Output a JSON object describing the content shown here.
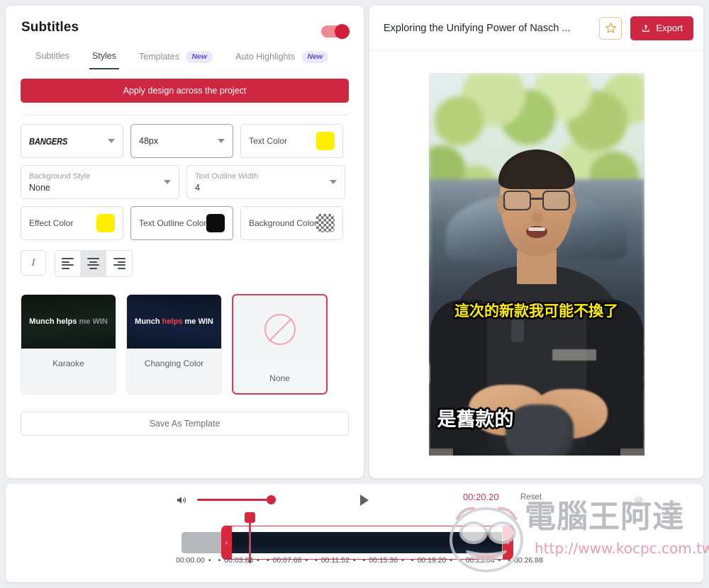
{
  "left_panel": {
    "title": "Subtitles",
    "toggle_on": true,
    "tabs": [
      {
        "label": "Subtitles",
        "active": false,
        "badge": ""
      },
      {
        "label": "Styles",
        "active": true,
        "badge": ""
      },
      {
        "label": "Templates",
        "active": false,
        "badge": "New"
      },
      {
        "label": "Auto Highlights",
        "active": false,
        "badge": "New"
      }
    ],
    "apply_button": "Apply design across the project",
    "controls": {
      "font_family": "BANGERS",
      "font_size": "48px",
      "text_color_label": "Text Color",
      "text_color_value": "#ffef00",
      "background_style_label": "Background Style",
      "background_style_value": "None",
      "text_outline_width_label": "Text Outline Width",
      "text_outline_width_value": "4",
      "effect_color_label": "Effect Color",
      "effect_color_value": "#ffef00",
      "text_outline_color_label": "Text Outline Color",
      "text_outline_color_value": "#0b0b0b",
      "background_color_label": "Background Color",
      "background_color_value": "transparent"
    },
    "style_buttons": {
      "italic": "I",
      "align_left": "align-left",
      "align_center": "align-center",
      "align_right": "align-right",
      "align_selected": "align-center"
    },
    "presets": [
      {
        "name": "Karaoke",
        "preview_words": [
          {
            "text": "Munch ",
            "state": "on"
          },
          {
            "text": "helps ",
            "state": "on"
          },
          {
            "text": "me ",
            "state": "off"
          },
          {
            "text": "WIN",
            "state": "off"
          }
        ],
        "selected": false
      },
      {
        "name": "Changing Color",
        "preview_words": [
          {
            "text": "Munch ",
            "state": "on"
          },
          {
            "text": "helps ",
            "state": "hi"
          },
          {
            "text": "me ",
            "state": "on"
          },
          {
            "text": "WIN",
            "state": "on"
          }
        ],
        "selected": false
      },
      {
        "name": "None",
        "preview_words": [],
        "selected": true
      }
    ],
    "save_template_button": "Save As Template"
  },
  "right_panel": {
    "project_title": "Exploring the Unifying Power of Nasch ...",
    "favorite_icon": "star-icon",
    "export_button": "Export",
    "export_icon": "upload-icon",
    "video": {
      "subtitle_primary": "這次的新款我可能不換了",
      "subtitle_primary_color": "#ffee00",
      "subtitle_secondary": "是舊款的",
      "subtitle_secondary_color": "#ffffff"
    }
  },
  "timeline": {
    "volume_icon": "speaker-icon",
    "volume_value": 100,
    "play_icon": "play-icon",
    "current_time": "00:20.20",
    "reset_button": "Reset",
    "markers": [
      "00:00.00",
      "00:03.84",
      "00:07.68",
      "00:11.52",
      "00:15.36",
      "00:19.20",
      "00:23.04",
      "00:26.88"
    ],
    "handle_left_icon": "chevron-left-icon",
    "handle_right_icon": "chevron-right-icon"
  },
  "watermark": {
    "brand_cjk": "電腦王阿達",
    "url": "http://www.kocpc.com.tw",
    "crown_icon": "crown-icon"
  },
  "colors": {
    "accent_red": "#cd2741",
    "subtitle_yellow": "#ffef00",
    "badge_purple": "#5b4fcf",
    "star_gold": "#e3c88f"
  }
}
